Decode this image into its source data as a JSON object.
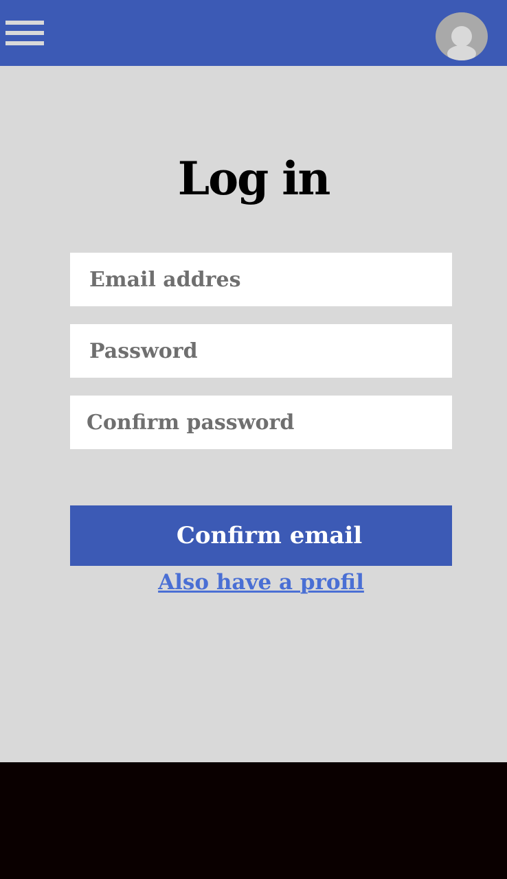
{
  "header": {
    "menu_icon": "hamburger-menu-icon",
    "avatar_icon": "user-avatar-icon"
  },
  "form": {
    "title": "Log in",
    "email_placeholder": "Email addres",
    "password_placeholder": "Password",
    "confirm_password_placeholder": "Confirm password",
    "submit_label": "Confirm email",
    "profile_link": "Also have a profil"
  },
  "colors": {
    "primary": "#3c5ab5",
    "background": "#d9d9d9",
    "link": "#4a6fd4",
    "footer": "#0a0000"
  }
}
